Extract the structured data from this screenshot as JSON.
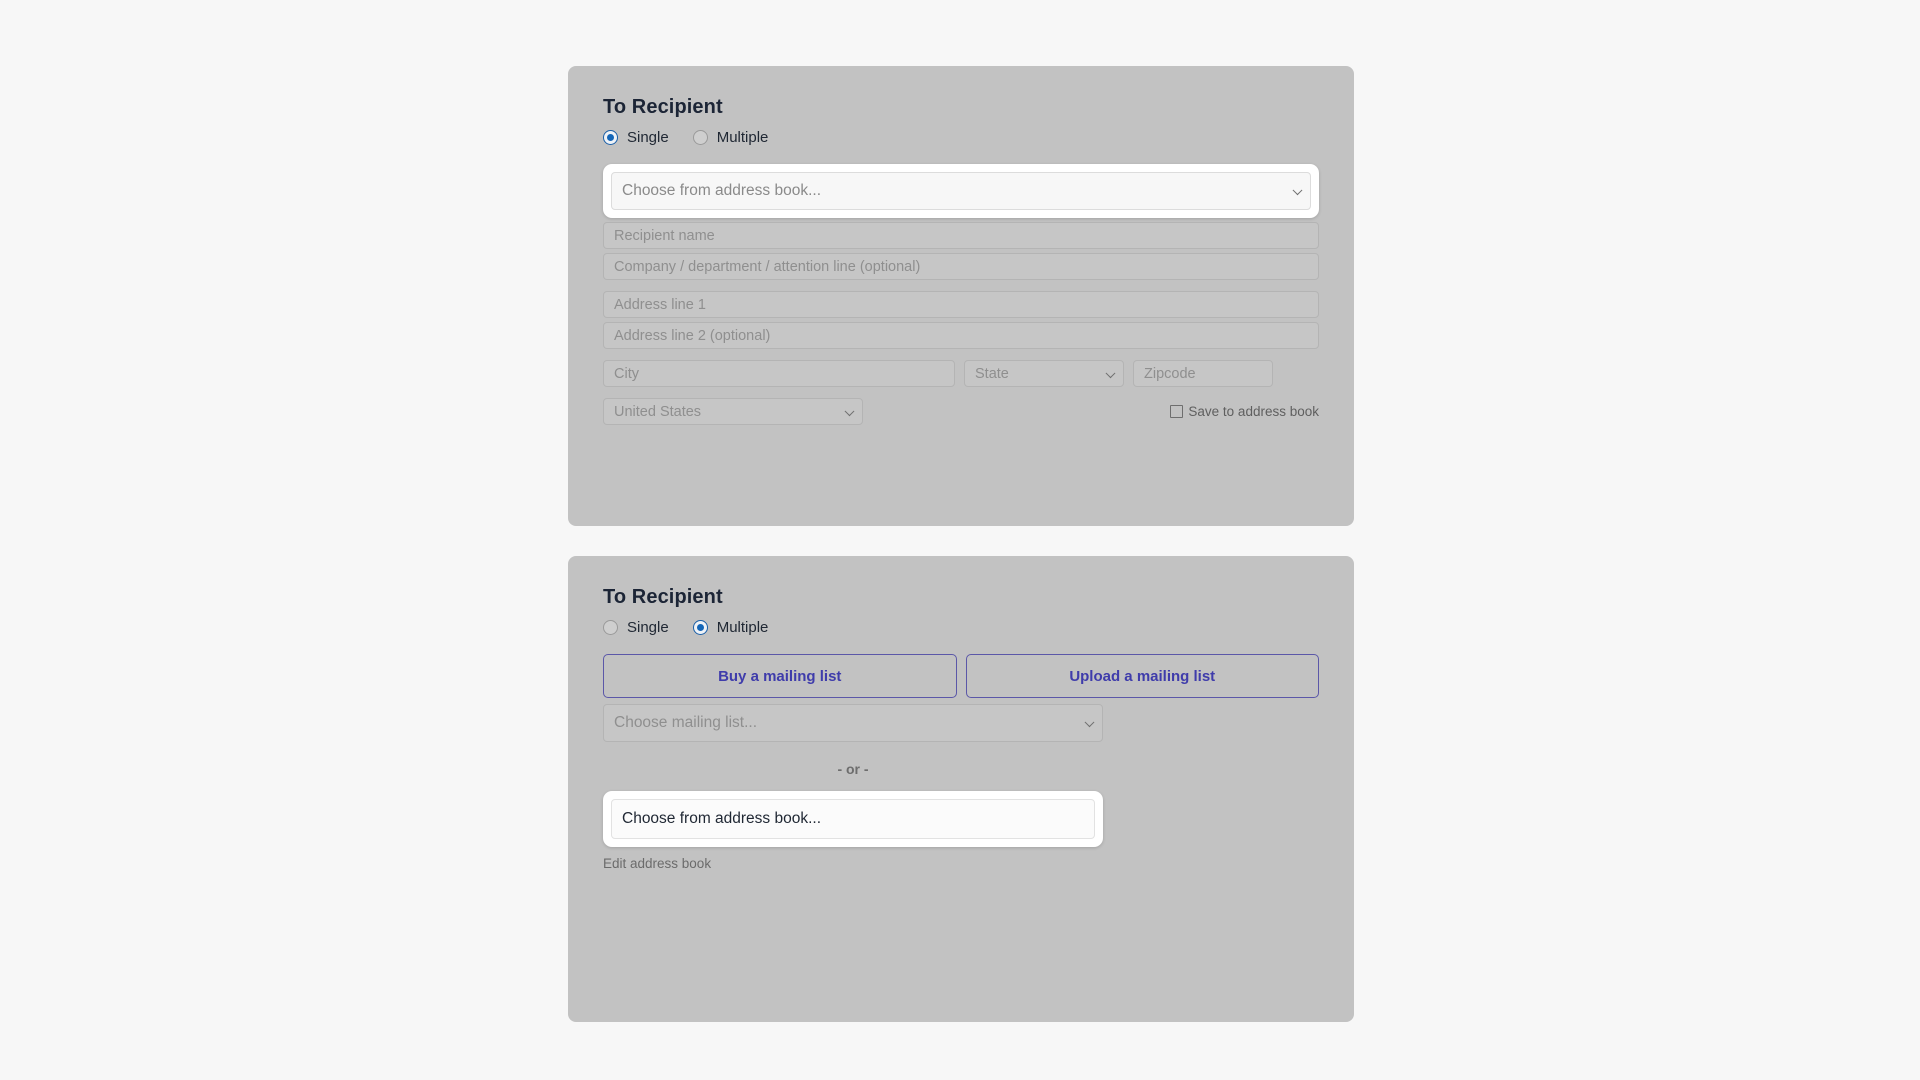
{
  "panels": [
    {
      "id": "single",
      "title": "To Recipient",
      "radios": [
        {
          "label": "Single",
          "checked": true
        },
        {
          "label": "Multiple",
          "checked": false
        }
      ],
      "address_book_select": {
        "placeholder": "Choose from address book...",
        "value": "",
        "focused": true
      },
      "fields": {
        "recipient_name": "Recipient name",
        "company": "Company / department / attention line (optional)",
        "address_line_1": "Address line 1",
        "address_line_2": "Address line 2 (optional)",
        "city": "City",
        "state": "State",
        "zipcode": "Zipcode",
        "country": "United States"
      },
      "save_checkbox": {
        "label": "Save to address book",
        "checked": false
      }
    },
    {
      "id": "multiple",
      "title": "To Recipient",
      "radios": [
        {
          "label": "Single",
          "checked": false
        },
        {
          "label": "Multiple",
          "checked": true
        }
      ],
      "buttons": {
        "buy": "Buy a mailing list",
        "upload": "Upload a mailing list"
      },
      "mailing_list_select": {
        "placeholder": "Choose mailing list...",
        "value": ""
      },
      "divider_text": "- or -",
      "address_book_button": {
        "label": "Choose from address book...",
        "focused": true
      },
      "edit_link": "Edit address book"
    }
  ],
  "colors": {
    "page_background": "#f7f7f7",
    "panel_background": "#c2c2c2",
    "heading": "#1c2536",
    "radio_accent": "#1466b8",
    "button_accent": "#3f3cab",
    "button_border": "#5b57a8",
    "placeholder": "#8f8f8f",
    "focus_halo": "#ffffff"
  }
}
